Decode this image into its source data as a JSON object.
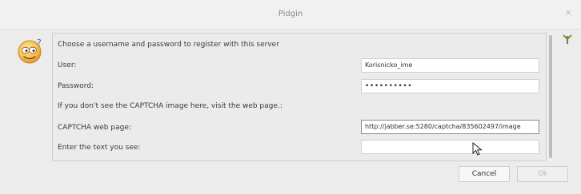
{
  "window": {
    "title": "Pidgin",
    "close_label": "×"
  },
  "icons": {
    "dialog_icon": "smiley-question-icon",
    "plugin_icon": "plugin-icon",
    "close_icon": "close-icon",
    "cursor": "mouse-pointer-icon"
  },
  "form": {
    "intro": "Choose a username and password to register with this server",
    "user_label": "User:",
    "user_value": "Korisnicko_ime",
    "password_label": "Password:",
    "password_value": "••••••••••",
    "captcha_note": "If you don't see the CAPTCHA image here, visit the web page.:",
    "captcha_url_label": "CAPTCHA web page:",
    "captcha_url_value": "http://jabber.se:5280/captcha/835602497/image",
    "captcha_text_label": "Enter the text you see:",
    "captcha_text_value": ""
  },
  "buttons": {
    "cancel_label": "Cancel",
    "ok_label": "Ok"
  },
  "colors": {
    "window_bg": "#ececec",
    "titlebar_bg": "#f1f1f1",
    "border": "#cfcfcf",
    "smiley_yellow": "#f5b34a"
  }
}
